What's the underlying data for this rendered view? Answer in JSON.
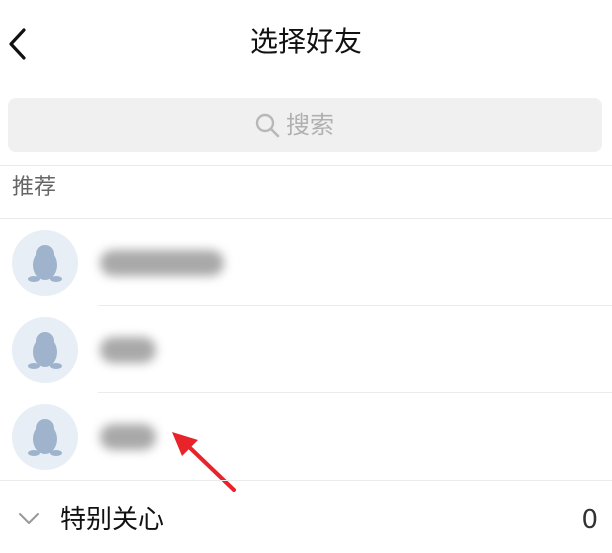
{
  "header": {
    "title": "选择好友",
    "back_icon": "back-chevron-icon"
  },
  "search": {
    "placeholder": "搜索",
    "icon": "search-icon"
  },
  "recommend": {
    "label": "推荐",
    "friends": [
      {
        "avatar_icon": "qq-penguin-icon",
        "name_blurred": true
      },
      {
        "avatar_icon": "qq-penguin-icon",
        "name_blurred": true
      },
      {
        "avatar_icon": "qq-penguin-icon",
        "name_blurred": true
      }
    ]
  },
  "groups": [
    {
      "label": "特别关心",
      "count": "0",
      "expanded": false
    }
  ],
  "colors": {
    "avatar_bg": "#e8eef6",
    "avatar_icon": "#9fb4cc",
    "annotation_arrow": "#e8232a"
  }
}
